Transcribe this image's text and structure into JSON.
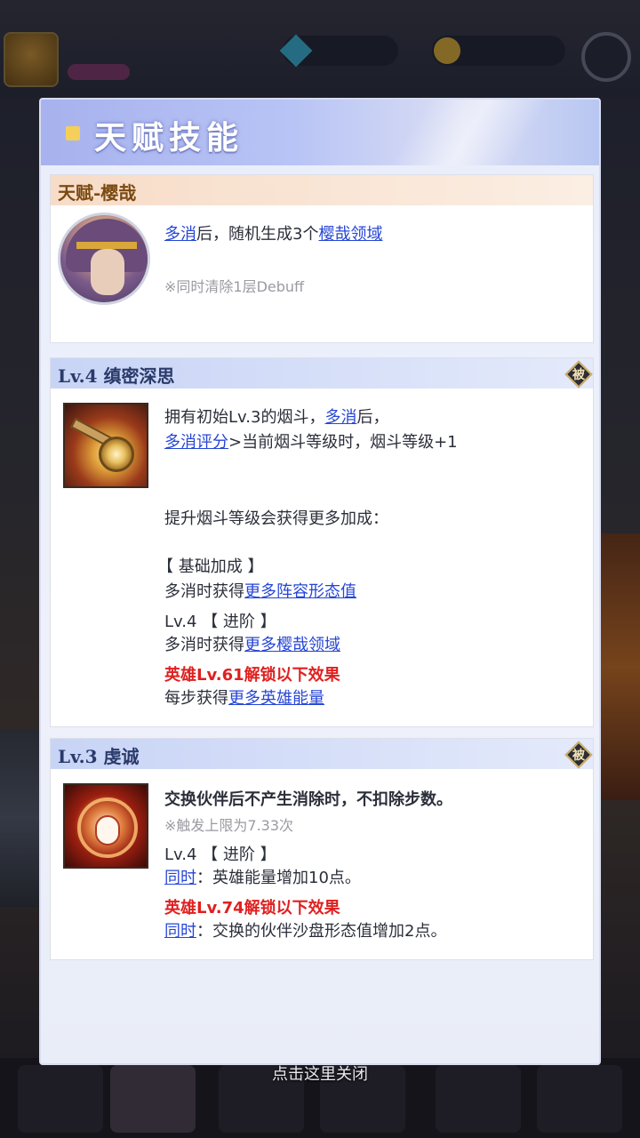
{
  "background": {
    "player_name": "",
    "close_hint": "点击这里关闭"
  },
  "panel": {
    "title": "天赋技能",
    "talent": {
      "header": "天赋-樱哉",
      "line1": {
        "pre": "",
        "link1": "多消",
        "mid": "后，随机生成3个",
        "link2": "樱哉领域",
        "post": ""
      },
      "note": "※同时清除1层Debuff"
    },
    "skill1": {
      "header": "Lv.4 缜密深思",
      "badge": "被",
      "line1": {
        "pre": "拥有初始Lv.3的烟斗，",
        "link": "多消",
        "post": "后，"
      },
      "line2": {
        "link": "多消评分",
        "post": ">当前烟斗等级时，烟斗等级+1"
      },
      "line3": "提升烟斗等级会获得更多加成：",
      "basic_title": "【 基础加成 】",
      "basic_line": {
        "pre": "多消时获得",
        "link": "更多阵容形态值"
      },
      "adv_title": "Lv.4 【 进阶 】",
      "adv_line": {
        "pre": "多消时获得",
        "link": "更多樱哉领域"
      },
      "unlock": "英雄Lv.61解锁以下效果",
      "unlock_line": {
        "pre": "每步获得",
        "link": "更多英雄能量"
      }
    },
    "skill2": {
      "header": "Lv.3 虔诚",
      "badge": "被",
      "line1": "交换伙伴后不产生消除时，不扣除步数。",
      "note": "※触发上限为7.33次",
      "adv_title": "Lv.4 【 进阶 】",
      "adv_line": {
        "link": "同时",
        "post": "：英雄能量增加10点。"
      },
      "unlock": "英雄Lv.74解锁以下效果",
      "unlock_line": {
        "link": "同时",
        "post": "：交换的伙伴沙盘形态值增加2点。"
      }
    }
  },
  "colors": {
    "link": "#2646d6",
    "unlock_red": "#e02020",
    "title_accent": "#f4cf5a"
  }
}
